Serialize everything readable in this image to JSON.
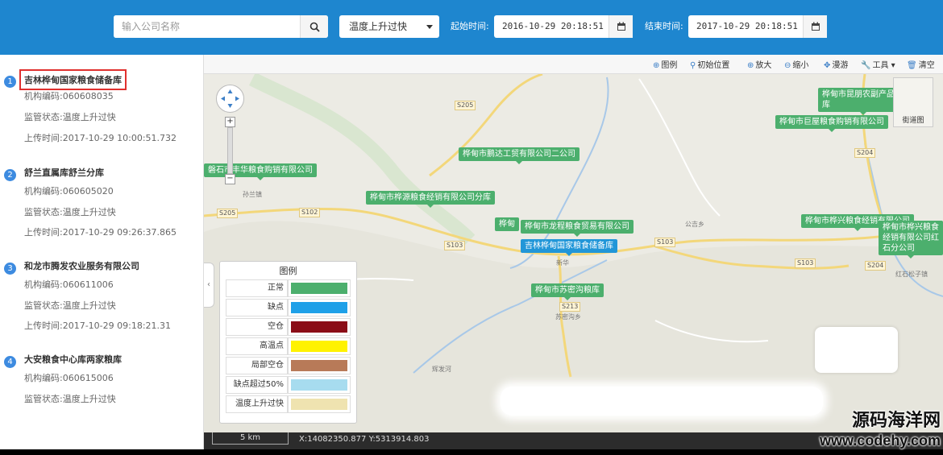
{
  "header": {
    "search": {
      "placeholder": "输入公司名称"
    },
    "filter": {
      "selected": "温度上升过快"
    },
    "start": {
      "label": "起始时间:",
      "value": "2016-10-29  20:18:51"
    },
    "end": {
      "label": "结束时间:",
      "value": "2017-10-29  20:18:51"
    }
  },
  "sidebar": {
    "items": [
      {
        "index": "1",
        "name": "吉林桦甸国家粮食储备库",
        "code": "机构编码:060608035",
        "status": "监管状态:温度上升过快",
        "time": "上传时间:2017-10-29 10:00:51.732"
      },
      {
        "index": "2",
        "name": "舒兰直属库舒兰分库",
        "code": "机构编码:060605020",
        "status": "监管状态:温度上升过快",
        "time": "上传时间:2017-10-29 09:26:37.865"
      },
      {
        "index": "3",
        "name": "和龙市腾发农业服务有限公司",
        "code": "机构编码:060611006",
        "status": "监管状态:温度上升过快",
        "time": "上传时间:2017-10-29 09:18:21.31"
      },
      {
        "index": "4",
        "name": "大安粮食中心库两家粮库",
        "code": "机构编码:060615006",
        "status": "监管状态:温度上升过快"
      }
    ]
  },
  "map": {
    "toolbar": {
      "legend": "图例",
      "home": "初始位置",
      "zoom_in": "放大",
      "zoom_out": "缩小",
      "pan": "漫游",
      "tools": "工具",
      "clear": "清空"
    },
    "overview_label": "街道图",
    "places": [
      "桦甸市昆朋农副产品分库",
      "桦甸市巨屋粮食购销有限公司",
      "桦甸市鹏达工贸有限公司二公司",
      "磐石市丰华粮食购销有限公司",
      "桦甸市桦源粮食经销有限公司分库",
      "桦甸",
      "桦甸市龙程粮食贸易有限公司",
      "吉林桦甸国家粮食储备库",
      "桦甸市苏密沟粮库",
      "桦甸市桦兴粮食经销有限公司",
      "桦甸市桦兴粮食经销有限公司红石分公司"
    ],
    "roads": [
      "S205",
      "S205",
      "S102",
      "S103",
      "S103",
      "S204",
      "S103",
      "S204",
      "S213"
    ],
    "towns": [
      "孙兰镇",
      "新华",
      "苏密沟乡",
      "公吉乡",
      "红石松子镇",
      "辉发河"
    ],
    "legend": {
      "title": "图例",
      "items": [
        {
          "label": "正常",
          "color": "#4caf6d"
        },
        {
          "label": "缺点",
          "color": "#1ea0e8"
        },
        {
          "label": "空仓",
          "color": "#8b0d17"
        },
        {
          "label": "高温点",
          "color": "#fff200"
        },
        {
          "label": "局部空仓",
          "color": "#b87a58"
        },
        {
          "label": "缺点超过50%",
          "color": "#a7dcef"
        },
        {
          "label": "温度上升过快",
          "color": "#efe3b0"
        }
      ]
    },
    "scale": "5 km",
    "coords": "X:14082350.877 Y:5313914.803"
  },
  "watermark": {
    "line1": "源码海洋网",
    "line2": "www.codehy.com"
  }
}
